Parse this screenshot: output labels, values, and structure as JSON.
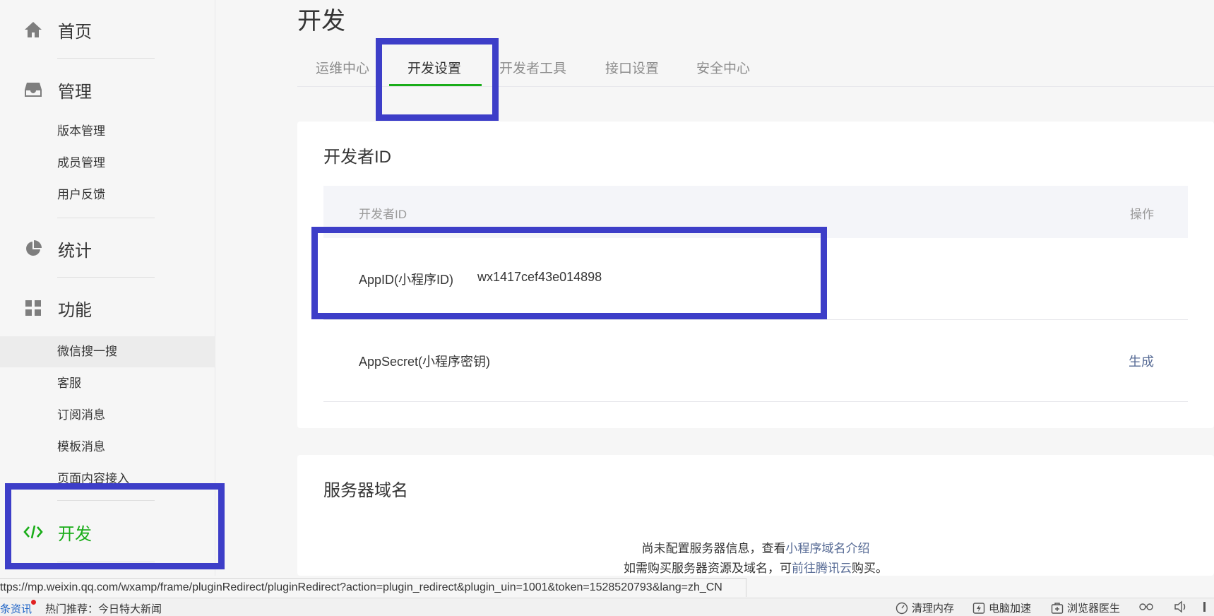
{
  "sidebar": {
    "home": "首页",
    "manage": "管理",
    "manage_items": [
      "版本管理",
      "成员管理",
      "用户反馈"
    ],
    "stats": "统计",
    "features": "功能",
    "feature_items": [
      "微信搜一搜",
      "客服",
      "订阅消息",
      "模板消息",
      "页面内容接入"
    ],
    "develop": "开发"
  },
  "main": {
    "title": "开发",
    "tabs": [
      "运维中心",
      "开发设置",
      "开发者工具",
      "接口设置",
      "安全中心"
    ],
    "active_tab": "开发设置"
  },
  "dev_id_card": {
    "title": "开发者ID",
    "header_col1": "开发者ID",
    "header_col2": "操作",
    "rows": [
      {
        "name": "AppID(小程序ID)",
        "value": "wx1417cef43e014898",
        "action": ""
      },
      {
        "name": "AppSecret(小程序密钥)",
        "value": "",
        "action": "生成"
      }
    ]
  },
  "server_card": {
    "title": "服务器域名",
    "line1_text": "尚未配置服务器信息，查看",
    "line1_link": "小程序域名介绍",
    "line2_text": "如需购买服务器资源及域名，可",
    "line2_link": "前往腾讯云",
    "line2_suffix": "购买。"
  },
  "status_bar": {
    "url": "ttps://mp.weixin.qq.com/wxamp/frame/pluginRedirect/pluginRedirect?action=plugin_redirect&plugin_uin=1001&token=1528520793&lang=zh_CN"
  },
  "bottom_bar": {
    "news": "条资讯",
    "hot": "热门推荐：今日特大新闻",
    "tools": [
      "清理内存",
      "电脑加速",
      "浏览器医生"
    ]
  },
  "colors": {
    "accent_green": "#1aad19",
    "link_blue": "#576b95",
    "highlight_box": "#3d3ec8"
  }
}
